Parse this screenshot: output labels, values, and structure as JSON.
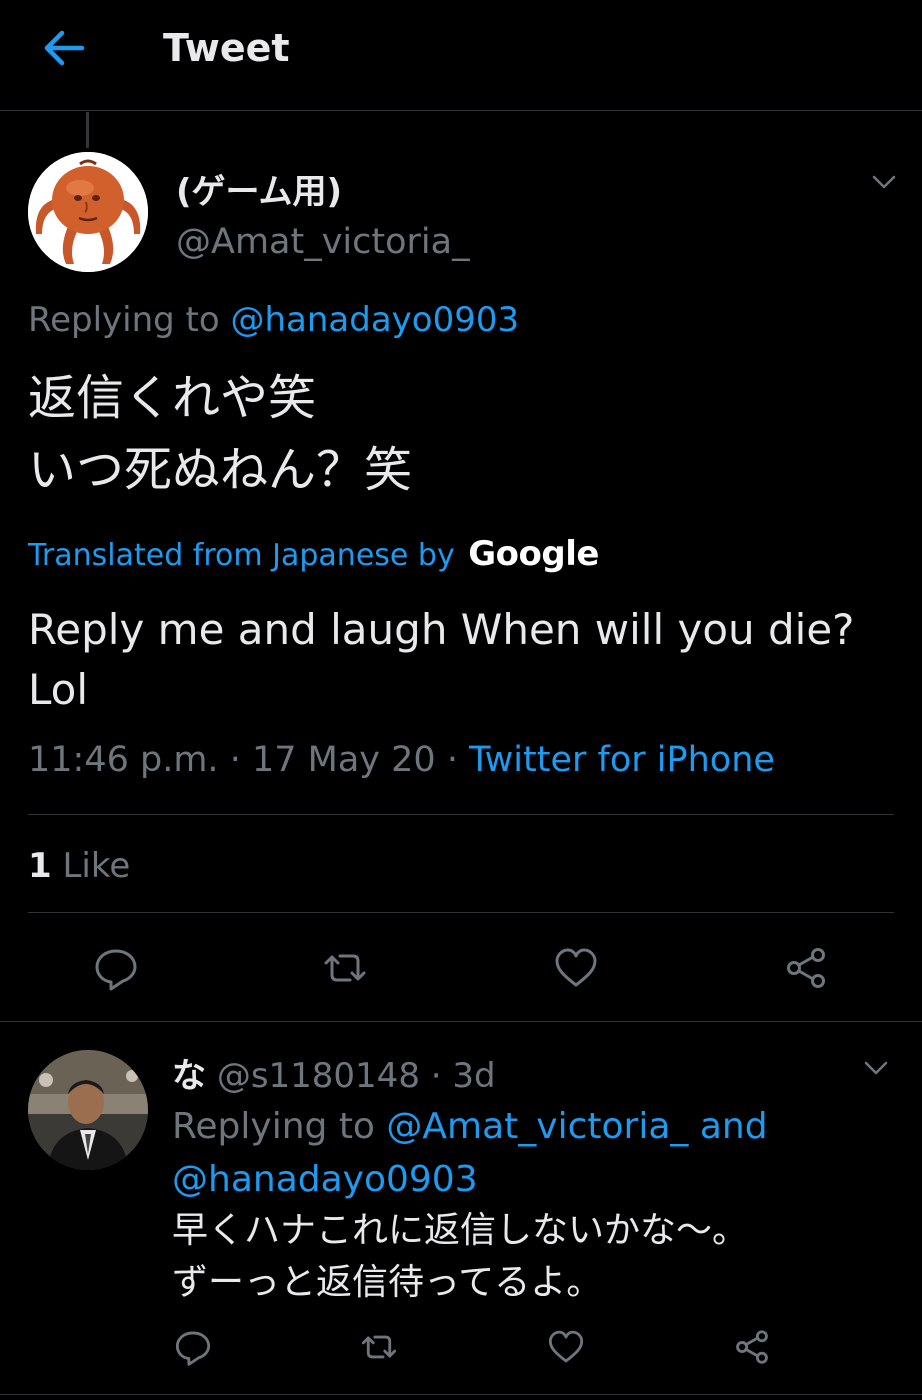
{
  "header": {
    "title": "Tweet",
    "back_icon": "arrow-left-icon"
  },
  "colors": {
    "background": "#000000",
    "accent": "#1d9bf0",
    "text": "#e7e9ea",
    "muted": "#6e767d",
    "divider": "#2f3336"
  },
  "tweet": {
    "display_name": "(ゲーム用)",
    "handle": "@Amat_victoria_",
    "replying_to_label": "Replying to",
    "replying_to_handle": "@hanadayo0903",
    "text_line1": "返信くれや笑",
    "text_line2": "いつ死ぬねん？笑",
    "translated_label": "Translated from Japanese by",
    "translated_provider": "Google",
    "translation": "Reply me and laugh When will you die? Lol",
    "time": "11:46 p.m.",
    "date": "17 May 20",
    "source": "Twitter for iPhone",
    "like_count": "1",
    "like_label": "Like"
  },
  "reply": {
    "display_name": "な",
    "handle": "@s1180148",
    "age": "3d",
    "replying_to_label": "Replying to",
    "replying_to_handles": "@Amat_victoria_ and @hanadayo0903",
    "text_line1": "早くハナこれに返信しないかな〜。",
    "text_line2": "ずーっと返信待ってるよ。"
  },
  "actions": {
    "icons": [
      "reply-icon",
      "retweet-icon",
      "like-icon",
      "share-icon"
    ]
  }
}
